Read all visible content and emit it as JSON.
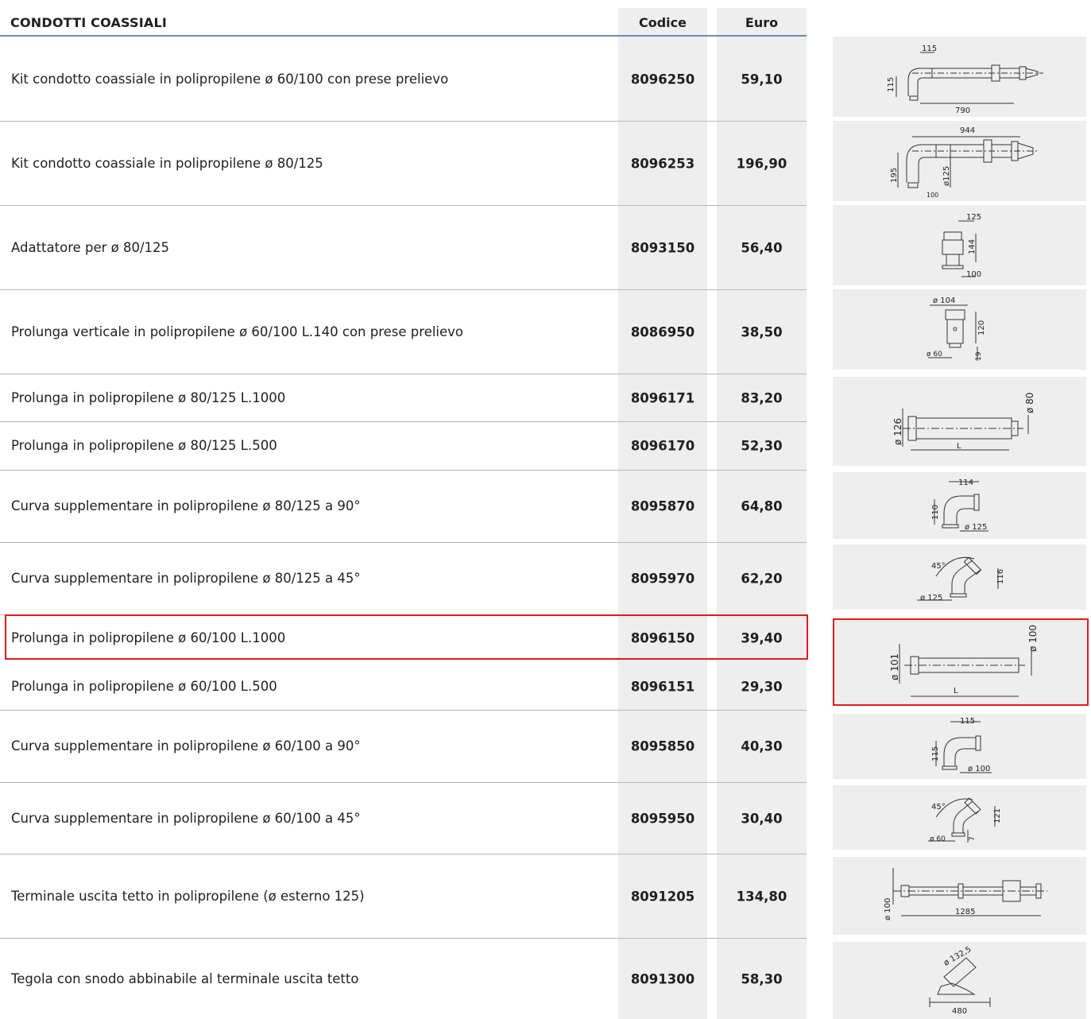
{
  "header": {
    "title": "CONDOTTI COASSIALI",
    "code_label": "Codice",
    "price_label": "Euro"
  },
  "rows": [
    {
      "description": "Kit condotto coassiale in polipropilene ø 60/100 con prese prelievo",
      "code": "8096250",
      "price": "59,10"
    },
    {
      "description": "Kit condotto coassiale in polipropilene ø 80/125",
      "code": "8096253",
      "price": "196,90"
    },
    {
      "description": "Adattatore per ø 80/125",
      "code": "8093150",
      "price": "56,40"
    },
    {
      "description": "Prolunga verticale in polipropilene ø 60/100 L.140 con prese prelievo",
      "code": "8086950",
      "price": "38,50"
    },
    {
      "description": "Prolunga in polipropilene ø 80/125 L.1000",
      "code": "8096171",
      "price": "83,20"
    },
    {
      "description": "Prolunga in polipropilene ø 80/125 L.500",
      "code": "8096170",
      "price": "52,30"
    },
    {
      "description": "Curva supplementare in polipropilene ø 80/125 a 90°",
      "code": "8095870",
      "price": "64,80"
    },
    {
      "description": "Curva supplementare in polipropilene ø 80/125 a 45°",
      "code": "8095970",
      "price": "62,20"
    },
    {
      "description": "Prolunga in polipropilene ø 60/100 L.1000",
      "code": "8096150",
      "price": "39,40"
    },
    {
      "description": "Prolunga in polipropilene ø 60/100 L.500",
      "code": "8096151",
      "price": "29,30"
    },
    {
      "description": "Curva supplementare in polipropilene ø 60/100 a 90°",
      "code": "8095850",
      "price": "40,30"
    },
    {
      "description": "Curva supplementare in polipropilene ø 60/100 a 45°",
      "code": "8095950",
      "price": "30,40"
    },
    {
      "description": "Terminale uscita tetto in polipropilene (ø esterno 125)",
      "code": "8091205",
      "price": "134,80"
    },
    {
      "description": "Tegola con snodo abbinabile al terminale uscita tetto",
      "code": "8091300",
      "price": "58,30"
    }
  ],
  "drawings": {
    "kit_60_100": [
      "115",
      "115",
      "790"
    ],
    "kit_80_125": [
      "944",
      "195",
      "ø125",
      "100"
    ],
    "adattatore": [
      "125",
      "144",
      "100"
    ],
    "prolunga_verticale": [
      "ø 104",
      "120",
      "ø 60",
      "19"
    ],
    "prolunga_80_125": [
      "ø 126",
      "ø 80",
      "L"
    ],
    "curva_80_125_90": [
      "114",
      "110",
      "ø 125"
    ],
    "curva_80_125_45": [
      "45°",
      "116",
      "ø 125"
    ],
    "prolunga_60_100": [
      "ø 101",
      "ø 100",
      "L"
    ],
    "curva_60_100_90": [
      "115",
      "115",
      "ø 100"
    ],
    "curva_60_100_45": [
      "45°",
      "121",
      "ø 60",
      "7"
    ],
    "terminale_tetto": [
      "ø 100",
      "1285"
    ],
    "tegola": [
      "ø 132,5",
      "480"
    ]
  },
  "highlight_color": "#e01b1b",
  "column_bg_color": "#eeeeee",
  "header_rule_color": "#6a8db6"
}
